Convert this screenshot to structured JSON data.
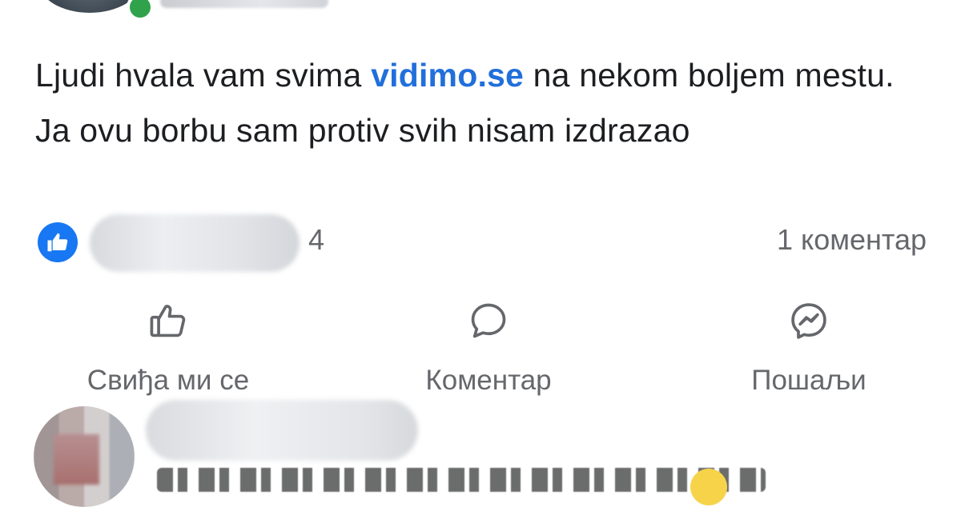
{
  "post": {
    "text_before_link": "Ljudi hvala vam svima ",
    "link_text": "vidimo.se",
    "text_after_link": " na nekom boljem mestu. Ja ovu borbu sam protiv svih nisam izdrazao"
  },
  "reactions": {
    "count": "4",
    "comment_count": "1 коментар"
  },
  "actions": {
    "like_label": "Свиђа ми се",
    "comment_label": "Коментар",
    "send_label": "Пошаљи"
  },
  "colors": {
    "link": "#216fdb",
    "like_badge": "#1877f2",
    "online": "#31a24c",
    "secondary_text": "#65676b"
  },
  "icons": {
    "like": "thumbs-up-icon",
    "comment": "speech-bubble-icon",
    "send": "messenger-icon",
    "reaction": "like-reaction-icon"
  }
}
